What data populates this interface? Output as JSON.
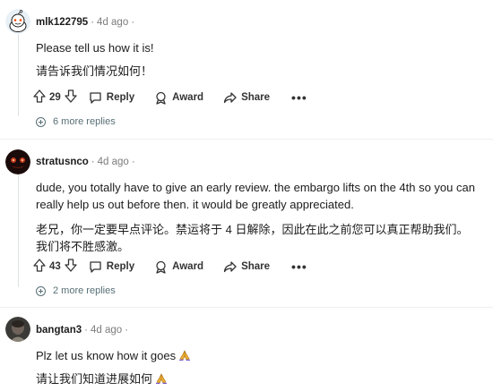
{
  "comments": [
    {
      "username": "mlk122795",
      "time": "4d ago",
      "lines": [
        "Please tell us how it is!",
        "请告诉我们情况如何！"
      ],
      "votes": "29",
      "reply_label": "Reply",
      "award_label": "Award",
      "share_label": "Share",
      "more_replies": "6 more replies"
    },
    {
      "username": "stratusnco",
      "time": "4d ago",
      "lines": [
        "dude, you totally have to give an early review. the embargo lifts on the 4th so you can really help us out before then. it would be greatly appreciated.",
        "老兄，你一定要早点评论。禁运将于 4 日解除，因此在此之前您可以真正帮助我们。我们将不胜感激。"
      ],
      "votes": "43",
      "reply_label": "Reply",
      "award_label": "Award",
      "share_label": "Share",
      "more_replies": "2 more replies"
    },
    {
      "username": "bangtan3",
      "time": "4d ago",
      "lines": [
        "Plz let us know how it goes",
        "请让我们知道进展如何"
      ],
      "emoji": "praying-hands"
    }
  ],
  "colors": {
    "text": "#1c1c1c",
    "meta": "#7c7c7c",
    "thread_line": "#dfe2e5",
    "more_replies": "#576f76"
  }
}
